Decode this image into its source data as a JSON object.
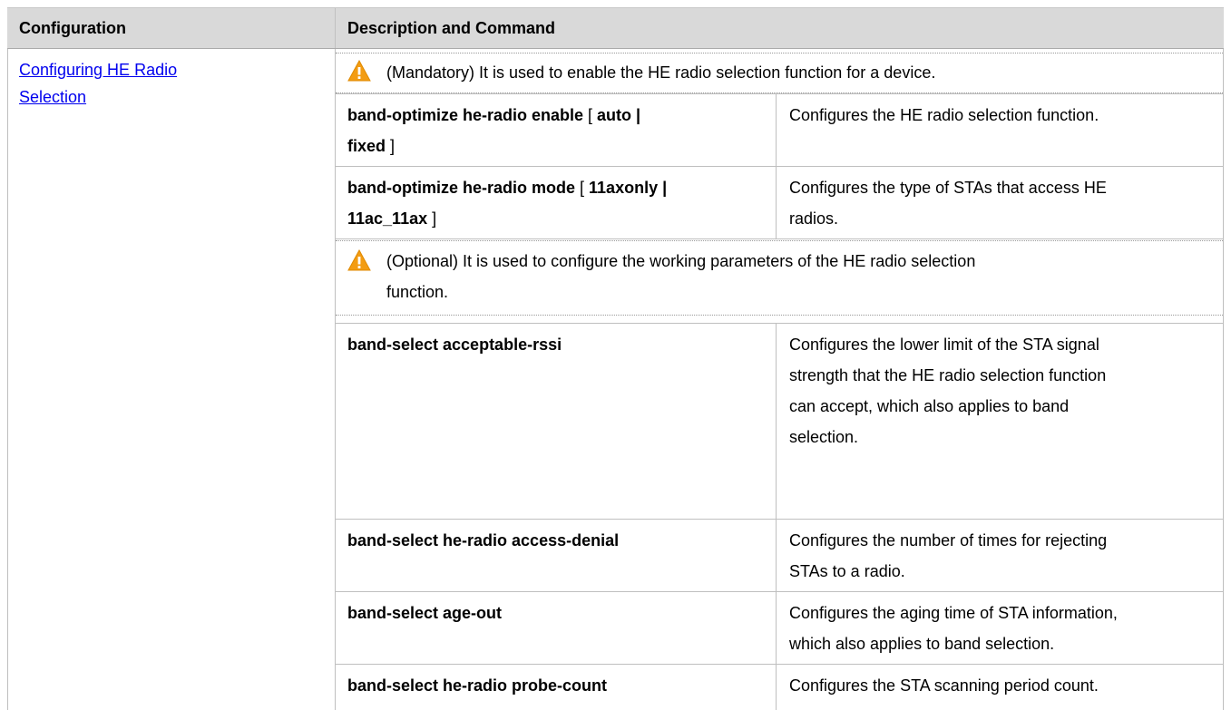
{
  "header": {
    "configuration": "Configuration",
    "description_and_command": "Description and Command"
  },
  "config_link": {
    "line1": "Configuring HE Radio ",
    "line2": "Selection"
  },
  "notes": [
    {
      "icon": "caution-icon",
      "text": "(Mandatory) It is used to enable the HE radio selection function for a device."
    },
    {
      "icon": "caution-icon",
      "text_line1": "(Optional) It is used to configure the working parameters of the HE radio selection",
      "text_line2": "function."
    }
  ],
  "rows": [
    {
      "cmd_bold1": "band-optimize he-radio enable",
      "cmd_plain1": " [ ",
      "cmd_bold2": "auto |",
      "cmd_bold3": "fixed",
      "cmd_plain2": " ]",
      "desc": "Configures the HE radio selection function."
    },
    {
      "cmd_bold1": "band-optimize he-radio mode",
      "cmd_plain1": " [ ",
      "cmd_bold2": "11axonly |",
      "cmd_bold3": "11ac_11ax",
      "cmd_plain2": " ]",
      "desc_line1": "Configures the type of STAs that access HE",
      "desc_line2": "radios."
    },
    {
      "cmd": "band-select acceptable-rssi",
      "desc_lines": [
        "Configures the lower limit of the STA signal",
        "strength that the HE radio selection function",
        "can accept, which also applies to band",
        "selection."
      ]
    },
    {
      "cmd": "band-select he-radio access-denial",
      "desc_lines": [
        "Configures the number of times for rejecting",
        "STAs to a radio."
      ]
    },
    {
      "cmd": "band-select age-out",
      "desc_lines": [
        "Configures the aging time of STA information,",
        "which also applies to band selection."
      ]
    },
    {
      "cmd": "band-select he-radio probe-count",
      "desc_lines": [
        "Configures the STA scanning period count."
      ]
    }
  ],
  "colors": {
    "header_bg": "#d9d9d9",
    "link": "#0000ee",
    "caution_fill": "#f39c12",
    "border": "#bfbfbf"
  }
}
